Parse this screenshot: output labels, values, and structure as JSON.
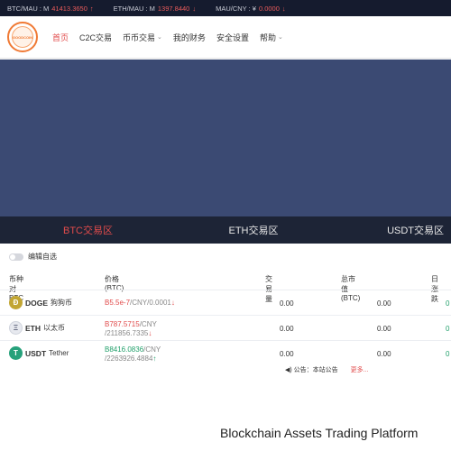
{
  "ticker": [
    {
      "pair": "BTC/MAU : M",
      "price": "41413.3650",
      "arrow": "↑"
    },
    {
      "pair": "ETH/MAU : M",
      "price": "1397.8440",
      "arrow": "↓"
    },
    {
      "pair": "MAU/CNY : ¥",
      "price": "0.0000",
      "arrow": "↓"
    }
  ],
  "nav": {
    "logo_text": "GOODCOIN",
    "items": [
      {
        "label": "首页",
        "chevron": false
      },
      {
        "label": "C2C交易",
        "chevron": false
      },
      {
        "label": "币币交易",
        "chevron": true
      },
      {
        "label": "我的财务",
        "chevron": false
      },
      {
        "label": "安全设置",
        "chevron": false
      },
      {
        "label": "帮助",
        "chevron": true
      }
    ]
  },
  "tabs": [
    "BTC交易区",
    "ETH交易区",
    "USDT交易区"
  ],
  "toggle_label": "编辑自选",
  "table": {
    "headers": {
      "pair": "币种对BTC",
      "price": "价格(BTC)",
      "volume": "交易量",
      "mcap": "总市值(BTC)",
      "change": "日涨跌"
    },
    "rows": [
      {
        "icon": "Ð",
        "icon_color": "#c2a633",
        "symbol": "DOGE",
        "name": "狗狗币",
        "price_line1": "B5.5e-7",
        "price_line1_tail": "/CNY/0.0001",
        "price_line2": "",
        "arrow": "↓",
        "volume": "0.00",
        "mcap": "0.00",
        "change": "0"
      },
      {
        "icon": "Ξ",
        "icon_color": "#e7e9ef",
        "symbol": "ETH",
        "name": "以太币",
        "price_line1": "B787.5715",
        "price_line1_tail": "/CNY",
        "price_line2": "/211856.7335",
        "arrow": "↓",
        "volume": "0.00",
        "mcap": "0.00",
        "change": "0"
      },
      {
        "icon": "T",
        "icon_color": "#26a17b",
        "symbol": "USDT",
        "name": "Tether",
        "price_line1": "B8416.0836",
        "price_line1_tail": "/CNY",
        "price_line2": "/2263926.4884",
        "arrow": "↑",
        "volume": "0.00",
        "mcap": "0.00",
        "change": "0"
      }
    ]
  },
  "notice": {
    "label": "公告：本站公告",
    "more": "更多..."
  },
  "footer_title": "Blockchain Assets Trading Platform"
}
